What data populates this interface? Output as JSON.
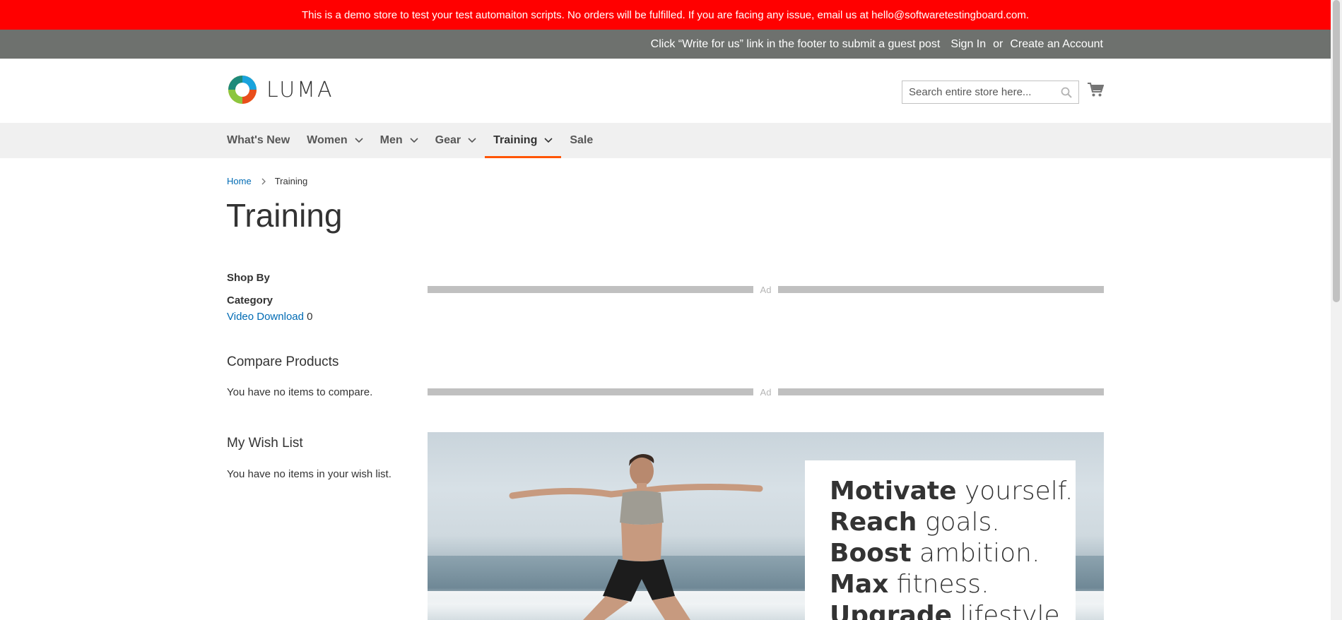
{
  "notice": {
    "text": "This is a demo store to test your test automaiton scripts. No orders will be fulfilled. If you are facing any issue, email us at hello@softwaretestingboard.com."
  },
  "top_panel": {
    "guest_post": "Click “Write for us” link in the footer to submit a guest post",
    "sign_in": "Sign In",
    "or": "or",
    "create_account": "Create an Account"
  },
  "header": {
    "logo_text": "LUMA",
    "search_placeholder": "Search entire store here...",
    "search_icon": "search-icon",
    "cart_icon": "shopping-cart-icon"
  },
  "nav": {
    "items": [
      {
        "label": "What's New",
        "has_dropdown": false
      },
      {
        "label": "Women",
        "has_dropdown": true
      },
      {
        "label": "Men",
        "has_dropdown": true
      },
      {
        "label": "Gear",
        "has_dropdown": true
      },
      {
        "label": "Training",
        "has_dropdown": true,
        "active": true
      },
      {
        "label": "Sale",
        "has_dropdown": false
      }
    ],
    "active_color": "#ff5501"
  },
  "breadcrumb": {
    "home": "Home",
    "current": "Training"
  },
  "page": {
    "title": "Training"
  },
  "sidebar": {
    "shop_by": "Shop By",
    "category_title": "Category",
    "category_link": "Video Download",
    "category_count": "0",
    "compare_title": "Compare Products",
    "compare_text": "You have no items to compare.",
    "wishlist_title": "My Wish List",
    "wishlist_text": "You have no items in your wish list."
  },
  "ads": {
    "label": "Ad"
  },
  "banner": {
    "lines": [
      {
        "bold": "Motivate",
        "light": "yourself."
      },
      {
        "bold": "Reach",
        "light": "goals."
      },
      {
        "bold": "Boost",
        "light": "ambition."
      },
      {
        "bold": "Max",
        "light": "fitness."
      },
      {
        "bold": "Upgrade",
        "light": "lifestyle."
      }
    ]
  },
  "colors": {
    "notice_bg": "#ff0000",
    "top_panel_bg": "#6e716e",
    "nav_bg": "#f0f0f0",
    "link": "#006bb4"
  }
}
